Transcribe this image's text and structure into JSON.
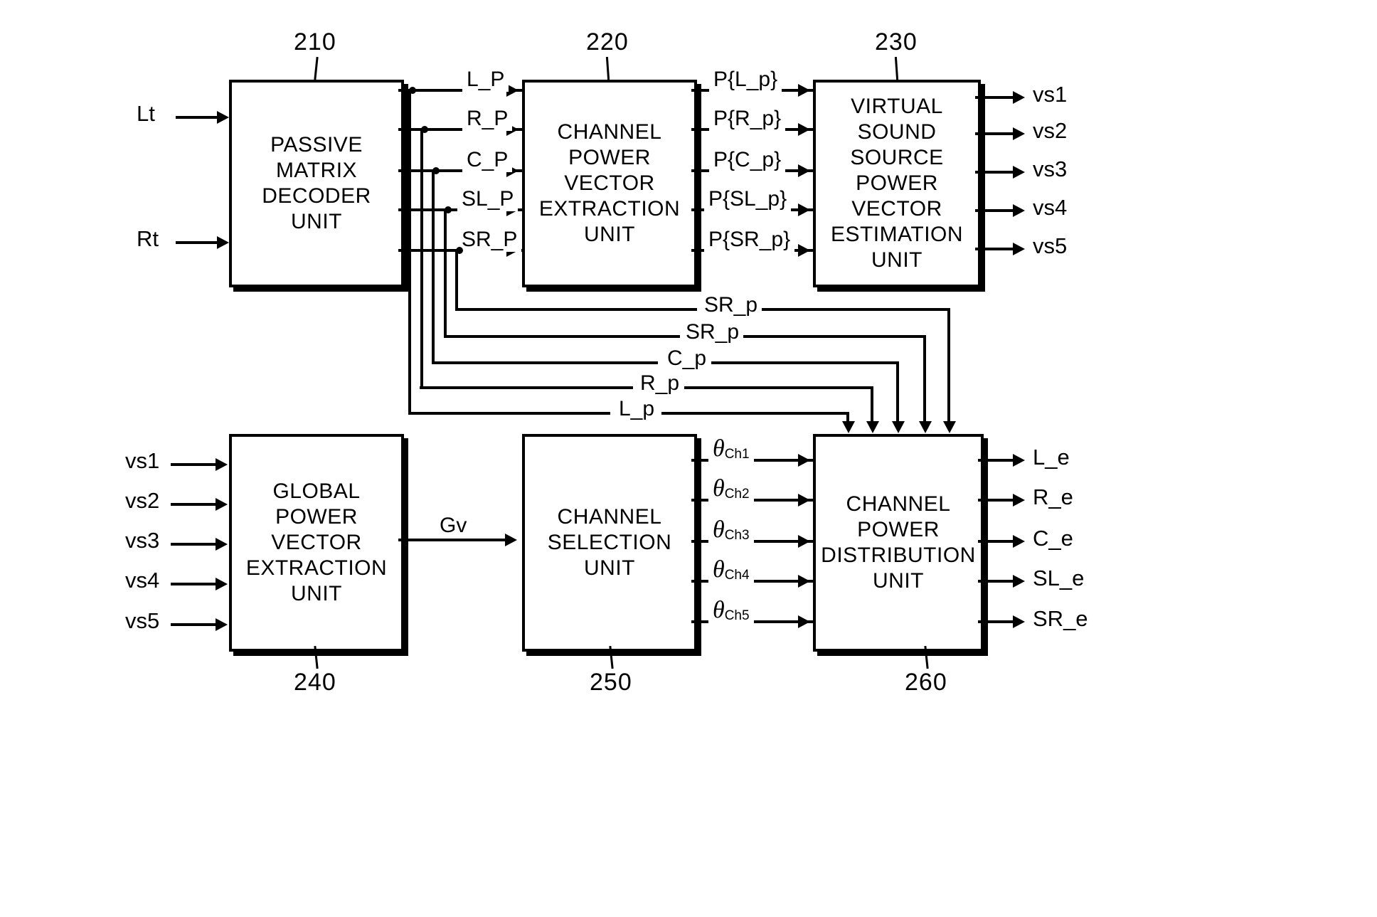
{
  "figure": {
    "type": "block-diagram",
    "title": "Audio decoding block diagram"
  },
  "blocks": [
    {
      "id": "210",
      "label": "PASSIVE\nMATRIX\nDECODER\nUNIT",
      "ref": "210"
    },
    {
      "id": "220",
      "label": "CHANNEL\nPOWER\nVECTOR\nEXTRACTION\nUNIT",
      "ref": "220"
    },
    {
      "id": "230",
      "label": "VIRTUAL\nSOUND\nSOURCE\nPOWER\nVECTOR\nESTIMATION\nUNIT",
      "ref": "230"
    },
    {
      "id": "240",
      "label": "GLOBAL\nPOWER\nVECTOR\nEXTRACTION\nUNIT",
      "ref": "240"
    },
    {
      "id": "250",
      "label": "CHANNEL\nSELECTION\nUNIT",
      "ref": "250"
    },
    {
      "id": "260",
      "label": "CHANNEL\nPOWER\nDISTRIBUTION\nUNIT",
      "ref": "260"
    }
  ],
  "block_text": {
    "b210_l1": "PASSIVE",
    "b210_l2": "MATRIX",
    "b210_l3": "DECODER",
    "b210_l4": "UNIT",
    "b220_l1": "CHANNEL",
    "b220_l2": "POWER",
    "b220_l3": "VECTOR",
    "b220_l4": "EXTRACTION",
    "b220_l5": "UNIT",
    "b230_l1": "VIRTUAL",
    "b230_l2": "SOUND",
    "b230_l3": "SOURCE",
    "b230_l4": "POWER",
    "b230_l5": "VECTOR",
    "b230_l6": "ESTIMATION",
    "b230_l7": "UNIT",
    "b240_l1": "GLOBAL",
    "b240_l2": "POWER",
    "b240_l3": "VECTOR",
    "b240_l4": "EXTRACTION",
    "b240_l5": "UNIT",
    "b250_l1": "CHANNEL",
    "b250_l2": "SELECTION",
    "b250_l3": "UNIT",
    "b260_l1": "CHANNEL",
    "b260_l2": "POWER",
    "b260_l3": "DISTRIBUTION",
    "b260_l4": "UNIT"
  },
  "ref_numbers": {
    "r210": "210",
    "r220": "220",
    "r230": "230",
    "r240": "240",
    "r250": "250",
    "r260": "260"
  },
  "inputs_top": {
    "lt": "Lt",
    "rt": "Rt"
  },
  "signals_210_to_220": [
    "L_P",
    "R_P",
    "C_P",
    "SL_P",
    "SR_P"
  ],
  "signals_220_to_230": [
    "P{L_p}",
    "P{R_p}",
    "P{C_p}",
    "P{SL_p}",
    "P{SR_p}"
  ],
  "outputs_230": [
    "vs1",
    "vs2",
    "vs3",
    "vs4",
    "vs5"
  ],
  "feedback_signals": [
    "SR_p",
    "SR_p",
    "C_p",
    "R_p",
    "L_p"
  ],
  "inputs_240": [
    "vs1",
    "vs2",
    "vs3",
    "vs4",
    "vs5"
  ],
  "signal_240_to_250": "Gv",
  "signals_250_to_260": [
    {
      "sym": "θ",
      "sub": "Ch1"
    },
    {
      "sym": "θ",
      "sub": "Ch2"
    },
    {
      "sym": "θ",
      "sub": "Ch3"
    },
    {
      "sym": "θ",
      "sub": "Ch4"
    },
    {
      "sym": "θ",
      "sub": "Ch5"
    }
  ],
  "outputs_260": [
    "L_e",
    "R_e",
    "C_e",
    "SL_e",
    "SR_e"
  ],
  "colors": {
    "ink": "#000000",
    "paper": "#ffffff"
  }
}
